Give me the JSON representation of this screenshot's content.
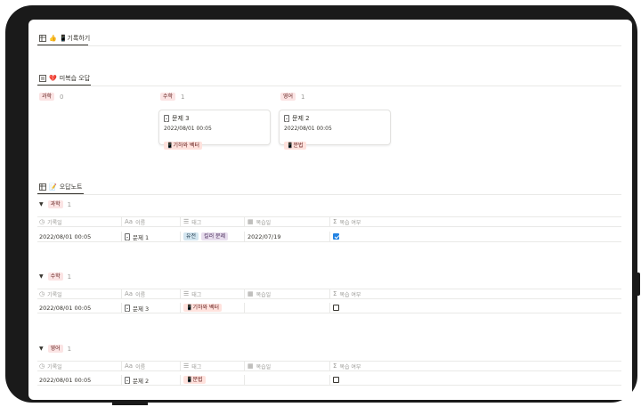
{
  "views": {
    "top_tab": {
      "icon": "table-icon",
      "emoji": "👍",
      "label": "📱기록하기"
    },
    "board_tab": {
      "icon": "board-icon",
      "emoji": "💔",
      "label": "미복습 오답"
    },
    "table_tab": {
      "icon": "table-icon",
      "emoji": "📝",
      "label": "오답노트"
    }
  },
  "board": {
    "columns": [
      {
        "tag": "과학",
        "count": "0",
        "cards": []
      },
      {
        "tag": "수학",
        "count": "1",
        "cards": [
          {
            "title": "문제 3",
            "date": "2022/08/01 00:05",
            "tag": "📱기하와 벡터"
          }
        ]
      },
      {
        "tag": "영어",
        "count": "1",
        "cards": [
          {
            "title": "문제 2",
            "date": "2022/08/01 00:05",
            "tag": "📱문법"
          }
        ]
      }
    ]
  },
  "table": {
    "headers": {
      "date": "기록일",
      "name": "이름",
      "tags": "태그",
      "review_date": "복습일",
      "reviewed": "복습 여부"
    },
    "header_icons": {
      "date": "clock-icon",
      "name": "text-icon",
      "tags": "list-icon",
      "review_date": "calendar-icon",
      "reviewed": "sigma-icon"
    },
    "groups": [
      {
        "tag": "과학",
        "count": "1",
        "rows": [
          {
            "date": "2022/08/01 00:05",
            "name": "문제 1",
            "tags": [
              "유전",
              "킬러 문제"
            ],
            "review_date": "2022/07/19",
            "reviewed": true
          }
        ]
      },
      {
        "tag": "수학",
        "count": "1",
        "rows": [
          {
            "date": "2022/08/01 00:05",
            "name": "문제 3",
            "tags": [
              "📱기하와 벡터"
            ],
            "review_date": "",
            "reviewed": false
          }
        ]
      },
      {
        "tag": "영어",
        "count": "1",
        "rows": [
          {
            "date": "2022/08/01 00:05",
            "name": "문제 2",
            "tags": [
              "📱문법"
            ],
            "review_date": "",
            "reviewed": false
          }
        ]
      }
    ]
  },
  "colors": {
    "accent": "#2383e2",
    "tag_red_bg": "#fbe4e4",
    "tag_blue_bg": "#d3e5ef",
    "tag_purple_bg": "#e8deee"
  }
}
